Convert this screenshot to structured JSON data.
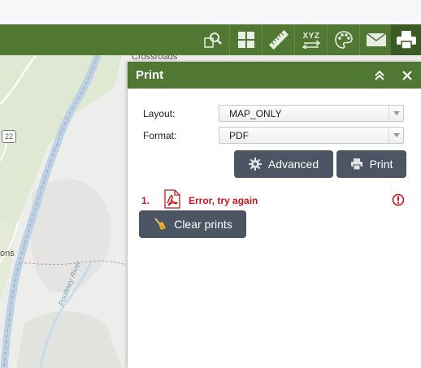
{
  "map": {
    "labels": {
      "crossroads": "Crossroads",
      "route_shield": "22",
      "place_fragment": "ons",
      "river": "Poultney River"
    }
  },
  "toolbar": {
    "tools": [
      {
        "name": "measure-search",
        "icon": "magnify-icon"
      },
      {
        "name": "basemap",
        "icon": "grid-icon"
      },
      {
        "name": "measure",
        "icon": "ruler-icon"
      },
      {
        "name": "coordinate",
        "icon": "xyz-icon"
      },
      {
        "name": "draw",
        "icon": "palette-icon"
      },
      {
        "name": "share",
        "icon": "envelope-icon"
      },
      {
        "name": "print",
        "icon": "printer-icon",
        "active": true
      }
    ],
    "coordinate_label": "XYZ"
  },
  "panel": {
    "title": "Print",
    "layout_label": "Layout:",
    "layout_value": "MAP_ONLY",
    "format_label": "Format:",
    "format_value": "PDF",
    "advanced_label": "Advanced",
    "print_label": "Print",
    "clear_label": "Clear prints",
    "print_results": [
      {
        "number": "1.",
        "message": "Error, try again"
      }
    ]
  },
  "colors": {
    "header_green": "#507832",
    "active_tool": "#3b5a24",
    "button_gray": "#4b5563",
    "error_red": "#d0141a"
  }
}
